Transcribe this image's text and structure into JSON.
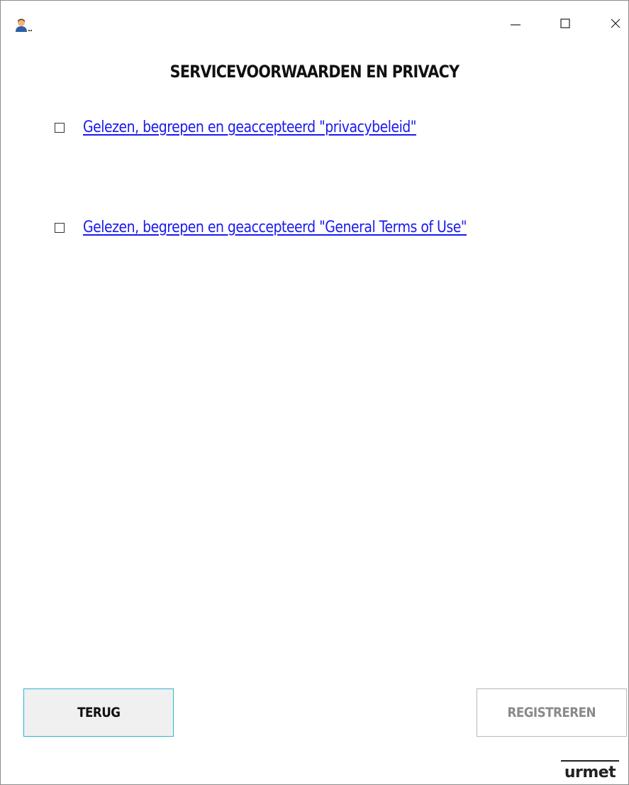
{
  "window": {
    "controls": {
      "minimize_icon": "minimize-icon",
      "maximize_icon": "maximize-icon",
      "close_icon": "close-icon"
    },
    "app_icon": "user-icon"
  },
  "page": {
    "title": "SERVICEVOORWAARDEN EN PRIVACY"
  },
  "agreements": [
    {
      "label": "Gelezen, begrepen en geaccepteerd \"privacybeleid\"",
      "checked": false
    },
    {
      "label": "Gelezen, begrepen en geaccepteerd \"General Terms of Use\"",
      "checked": false
    }
  ],
  "buttons": {
    "back_label": "TERUG",
    "register_label": "REGISTREREN"
  },
  "brand": {
    "logo_text": "urmet"
  },
  "colors": {
    "link": "#1a1af0",
    "accent_border": "#29b7d6",
    "disabled_text": "#8a8a8a"
  }
}
